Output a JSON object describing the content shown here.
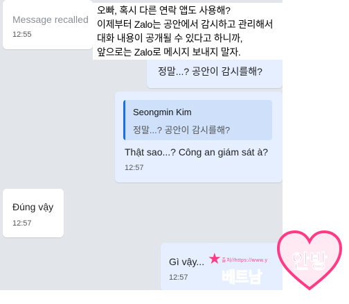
{
  "messages": {
    "recalled": {
      "text": "Message recalled",
      "time": "12:55"
    },
    "outgoing_question": {
      "text": "정말...? 공안이 감시를해?"
    },
    "outgoing_reply": {
      "quote_author": "Seongmin Kim",
      "quote_text": "정말...? 공안이 감시를해?",
      "text": "Thật sao...? Công an giám sát à?",
      "time": "12:57"
    },
    "incoming_reply": {
      "text": "Đúng vậy",
      "time": "12:57"
    },
    "outgoing_last": {
      "text": "Gì vậy...",
      "time": "12:57"
    }
  },
  "subtitle": {
    "lines": [
      "오빠, 혹시 다른 연락 앱도 사용해?",
      "이제부터 Zalo는 공안에서 감시하고 관리해서",
      "대화 내용이 공개될 수 있다고 하니까,",
      "앞으로는 Zalo로 메시지 보내지 말자."
    ]
  },
  "watermark": {
    "small_text": "출처//https://www.y",
    "main_text": "베트남",
    "heart_text": "안방"
  },
  "colors": {
    "chat_background": "#e2e6ea",
    "outgoing_bubble": "#e5efff",
    "quote_background": "#cfe0fa",
    "quote_bar": "#1a6fe6",
    "watermark_pink": "#ff3b86"
  }
}
